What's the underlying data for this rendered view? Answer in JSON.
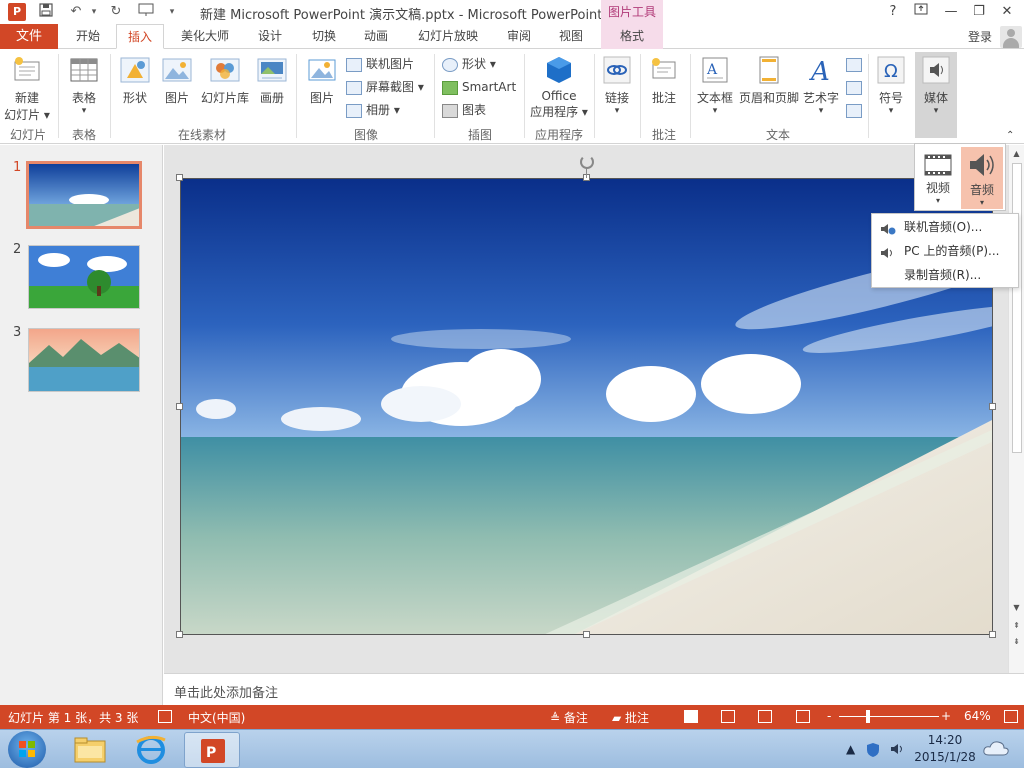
{
  "titlebar": {
    "app_logo": "P",
    "title": "新建 Microsoft PowerPoint 演示文稿.pptx - Microsoft PowerPoint",
    "context_header": "图片工具",
    "help": "?"
  },
  "tabs": {
    "file": "文件",
    "items": [
      "开始",
      "插入",
      "美化大师",
      "设计",
      "切换",
      "动画",
      "幻灯片放映",
      "审阅",
      "视图",
      "格式"
    ],
    "active": "插入",
    "login": "登录"
  },
  "ribbon": {
    "new_slide": "新建",
    "new_slide2": "幻灯片",
    "table": "表格",
    "shape": "形状",
    "picture_online": "图片",
    "slide_library": "幻灯片库",
    "album_online": "画册",
    "picture": "图片",
    "online_picture": "联机图片",
    "screenshot": "屏幕截图",
    "photo_album": "相册",
    "shapes": "形状",
    "smartart": "SmartArt",
    "chart": "图表",
    "office_apps": "Office",
    "office_apps2": "应用程序",
    "link": "链接",
    "comment": "批注",
    "textbox": "文本框",
    "header_footer": "页眉和页脚",
    "wordart": "艺术字",
    "symbol": "符号",
    "media": "媒体",
    "groups": {
      "slides": "幻灯片",
      "tables": "表格",
      "online_material": "在线素材",
      "images": "图像",
      "illustrations": "插图",
      "apps": "应用程序",
      "comments": "批注",
      "text": "文本"
    }
  },
  "media_panel": {
    "video": "视频",
    "audio": "音频"
  },
  "audio_menu": [
    {
      "label": "联机音频(O)...",
      "icon": "online-audio-icon"
    },
    {
      "label": "PC 上的音频(P)...",
      "icon": "speaker-icon"
    },
    {
      "label": "录制音频(R)...",
      "icon": ""
    }
  ],
  "slides": {
    "numbers": [
      "1",
      "2",
      "3"
    ],
    "selected": 1
  },
  "notes": {
    "placeholder": "单击此处添加备注"
  },
  "statusbar": {
    "slide_info": "幻灯片 第 1 张，共 3 张",
    "language": "中文(中国)",
    "notes": "备注",
    "comments": "批注",
    "zoom_minus": "-",
    "zoom_plus": "+",
    "zoom": "64%"
  },
  "taskbar": {
    "time": "14:20",
    "date": "2015/1/28"
  },
  "colors": {
    "accent": "#d24726",
    "picture_tools": "#f6dcea",
    "audio_highlight": "#f6c2ad"
  }
}
